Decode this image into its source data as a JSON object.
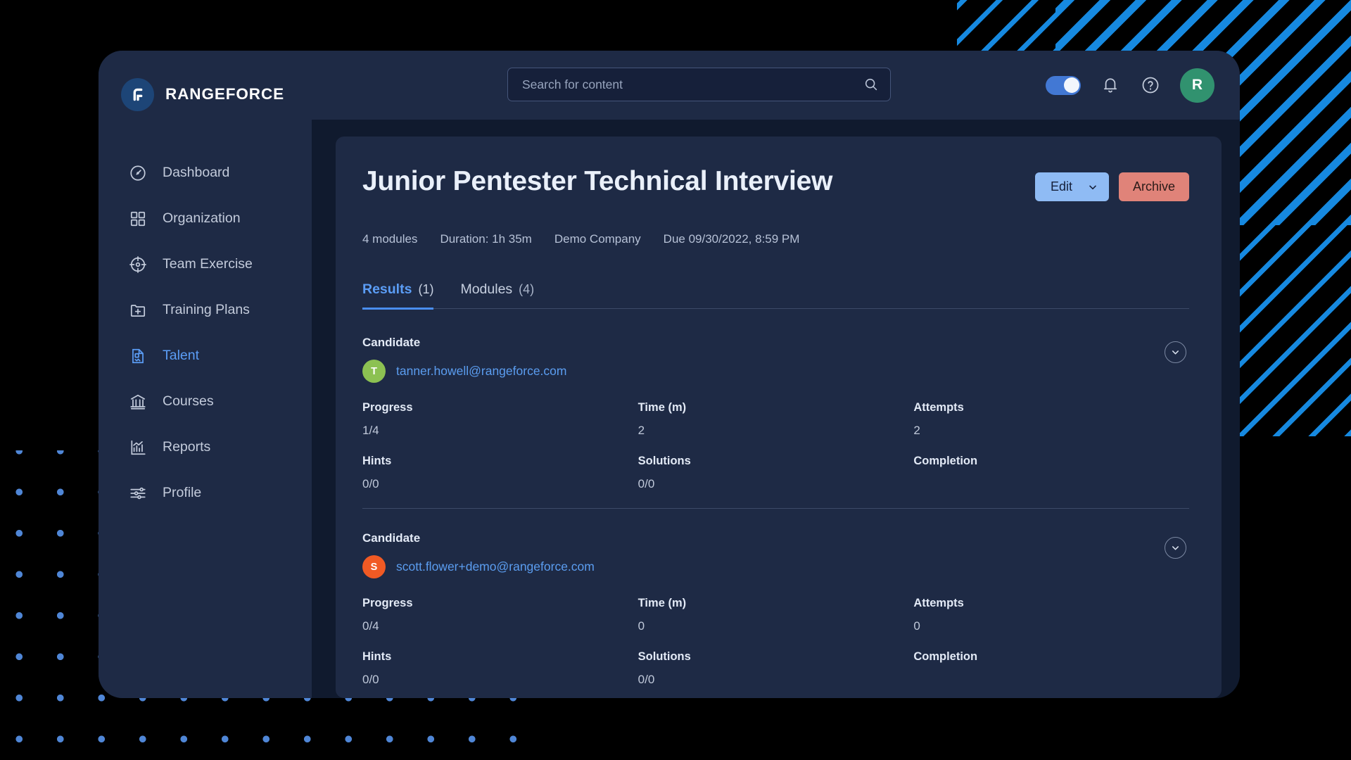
{
  "brand": {
    "name": "RANGEFORCE",
    "logo_icon": "rangeforce-logo-icon"
  },
  "sidebar": {
    "items": [
      {
        "label": "Dashboard",
        "icon": "speedometer-icon",
        "active": false
      },
      {
        "label": "Organization",
        "icon": "grid-squares-icon",
        "active": false
      },
      {
        "label": "Team Exercise",
        "icon": "target-icon",
        "active": false
      },
      {
        "label": "Training Plans",
        "icon": "folder-plus-icon",
        "active": false
      },
      {
        "label": "Talent",
        "icon": "document-user-icon",
        "active": true
      },
      {
        "label": "Courses",
        "icon": "bank-icon",
        "active": false
      },
      {
        "label": "Reports",
        "icon": "bar-chart-icon",
        "active": false
      },
      {
        "label": "Profile",
        "icon": "sliders-icon",
        "active": false
      }
    ]
  },
  "topbar": {
    "search": {
      "placeholder": "Search for content",
      "value": "",
      "icon": "search-icon"
    },
    "dark_mode_toggle": {
      "icon": "toggle-switch-icon",
      "state": "on"
    },
    "notifications_icon": "bell-icon",
    "help_icon": "question-circle-icon",
    "avatar": {
      "initial": "R",
      "color": "#31926f"
    }
  },
  "page": {
    "title": "Junior Pentester Technical Interview",
    "actions": {
      "edit_label": "Edit",
      "edit_chevron_icon": "chevron-down-icon",
      "archive_label": "Archive"
    },
    "meta": [
      "4 modules",
      "Duration: 1h 35m",
      "Demo Company",
      "Due 09/30/2022, 8:59 PM"
    ],
    "tabs": [
      {
        "label": "Results",
        "count": "(1)",
        "active": true
      },
      {
        "label": "Modules",
        "count": "(4)",
        "active": false
      }
    ]
  },
  "results": {
    "candidate_label": "Candidate",
    "expand_icon": "chevron-down-icon",
    "stat_labels": {
      "progress": "Progress",
      "time": "Time (m)",
      "attempts": "Attempts",
      "hints": "Hints",
      "solutions": "Solutions",
      "completion": "Completion"
    },
    "rows": [
      {
        "initial": "T",
        "avatar_color": "#8cc152",
        "email": "tanner.howell@rangeforce.com",
        "progress": "1/4",
        "time": "2",
        "attempts": "2",
        "hints": "0/0",
        "solutions": "0/0",
        "completion": ""
      },
      {
        "initial": "S",
        "avatar_color": "#f15a24",
        "email": "scott.flower+demo@rangeforce.com",
        "progress": "0/4",
        "time": "0",
        "attempts": "0",
        "hints": "0/0",
        "solutions": "0/0",
        "completion": ""
      }
    ]
  },
  "theme": {
    "background": "#000000",
    "window_bg": "#101a2e",
    "panel_bg": "#1e2a45",
    "accent_blue": "#5b9df6",
    "stripe_blue": "#1689e0",
    "dot_blue": "#4f86d6",
    "edit_button": "#8fbbf4",
    "archive_button": "#e08379"
  }
}
